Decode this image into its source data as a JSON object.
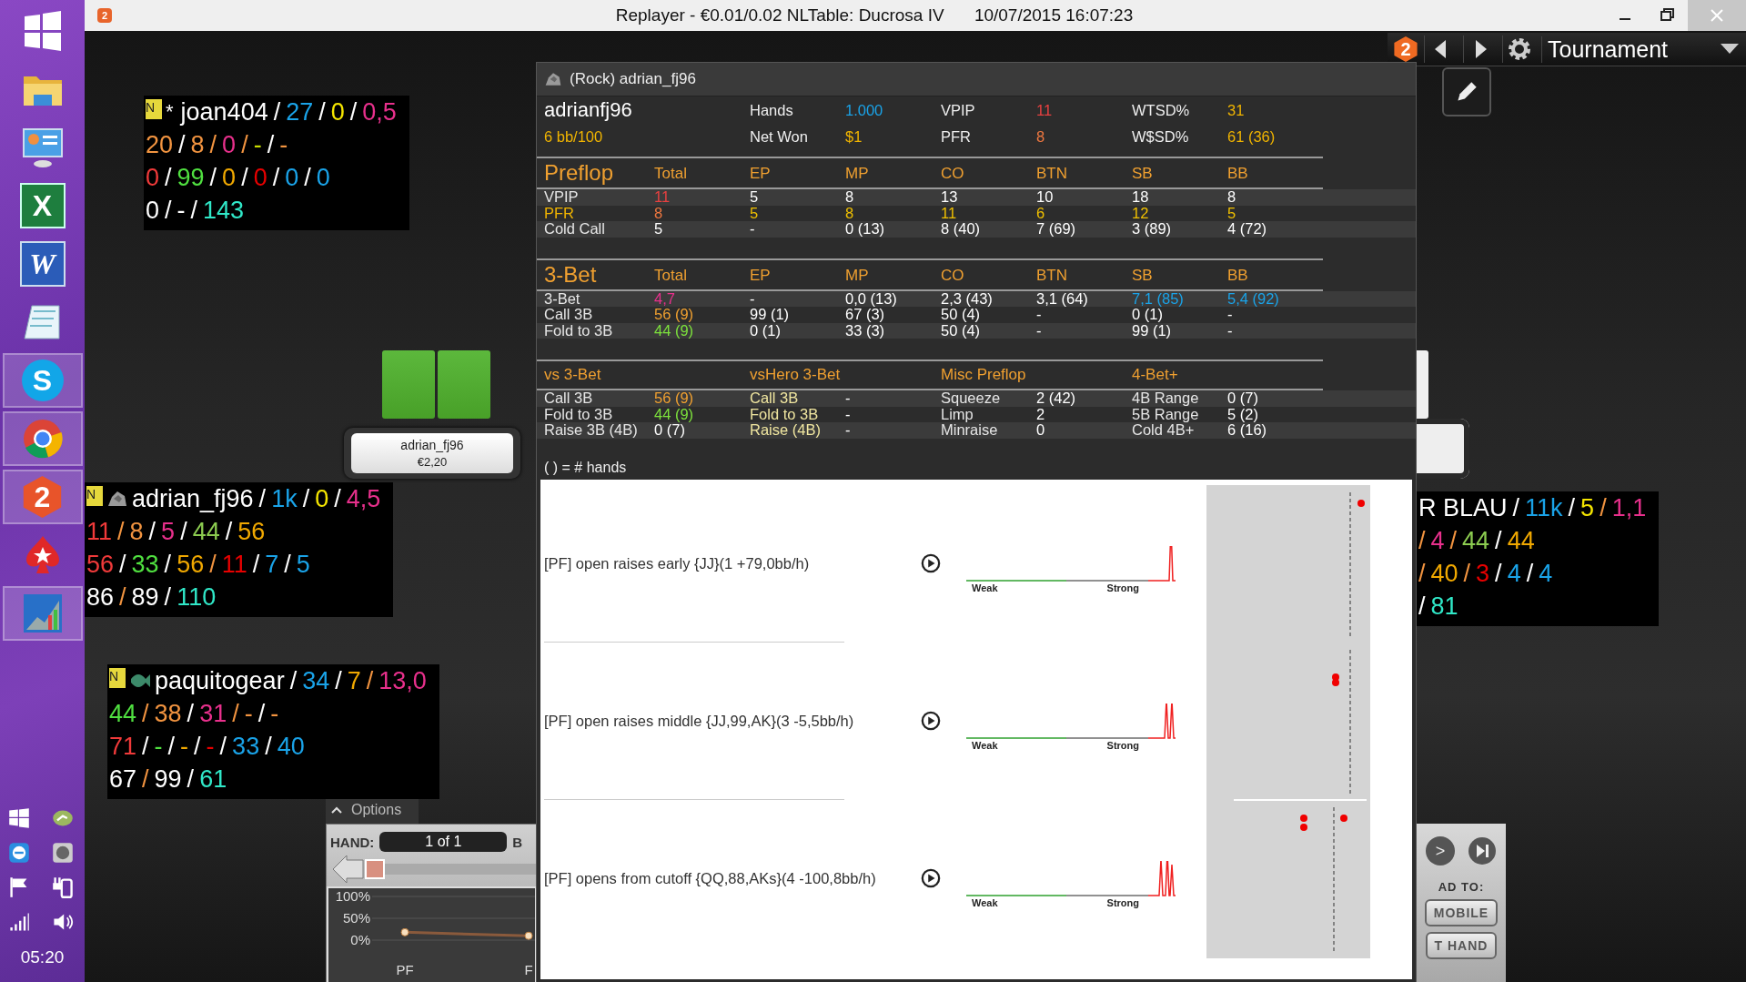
{
  "window": {
    "app_badge": "2",
    "title": "Replayer - €0.01/0.02 NLTable: Ducrosa IV",
    "timestamp": "10/07/2015 16:07:23"
  },
  "taskbar": {
    "apps": [
      {
        "kind": "start",
        "running": false
      },
      {
        "kind": "folder",
        "running": false
      },
      {
        "kind": "control-panel",
        "running": false
      },
      {
        "kind": "spreadsheet",
        "glyph": "X",
        "running": false
      },
      {
        "kind": "document",
        "glyph": "W",
        "running": false
      },
      {
        "kind": "notepad",
        "running": false
      },
      {
        "kind": "chat",
        "glyph": "S",
        "running": true
      },
      {
        "kind": "browser",
        "running": true
      },
      {
        "kind": "tracker",
        "glyph": "2",
        "running": true
      },
      {
        "kind": "poker",
        "running": false
      },
      {
        "kind": "chart",
        "running": true
      }
    ],
    "clock": "05:20"
  },
  "toolbar": {
    "badge": "2",
    "mode": "Tournament"
  },
  "huds": [
    {
      "badge": "N",
      "prefix": "*",
      "lines": [
        [
          {
            "t": "joan404",
            "color": "#ffffff"
          },
          {
            "t": "/",
            "color": "#ffffff"
          },
          {
            "t": "27",
            "color": "#1aa3e8"
          },
          {
            "t": "/",
            "color": "#ffffff"
          },
          {
            "t": "0",
            "color": "#f5e600"
          },
          {
            "t": "/",
            "color": "#ffffff"
          },
          {
            "t": "0,5",
            "color": "#e8308c"
          }
        ],
        [
          {
            "t": "20",
            "color": "#f29440"
          },
          {
            "t": "/",
            "color": "#ffffff"
          },
          {
            "t": "8",
            "color": "#f29440"
          },
          {
            "t": "/",
            "color": "#f29440"
          },
          {
            "t": "0",
            "color": "#e8308c"
          },
          {
            "t": "/",
            "color": "#f29440"
          },
          {
            "t": "-",
            "color": "#c8dc00"
          },
          {
            "t": "/",
            "color": "#ffffff"
          },
          {
            "t": "-",
            "color": "#f29440"
          }
        ],
        [
          {
            "t": "0",
            "color": "#f03a3a"
          },
          {
            "t": "/",
            "color": "#ffffff"
          },
          {
            "t": "99",
            "color": "#50e040"
          },
          {
            "t": "/",
            "color": "#ffffff"
          },
          {
            "t": "0",
            "color": "#f0a800"
          },
          {
            "t": "/",
            "color": "#ffffff"
          },
          {
            "t": "0",
            "color": "#e80000"
          },
          {
            "t": "/",
            "color": "#ffffff"
          },
          {
            "t": "0",
            "color": "#1aa3e8"
          },
          {
            "t": "/",
            "color": "#ffffff"
          },
          {
            "t": "0",
            "color": "#1aa3e8"
          }
        ],
        [
          {
            "t": "0",
            "color": "#ffffff"
          },
          {
            "t": "/",
            "color": "#ffffff"
          },
          {
            "t": "-",
            "color": "#ffffff"
          },
          {
            "t": "/",
            "color": "#ffffff"
          },
          {
            "t": "143",
            "color": "#30e8c8"
          }
        ]
      ]
    },
    {
      "badge": "N",
      "kind": "rock",
      "lines": [
        [
          {
            "t": "adrian_fj96",
            "color": "#ffffff"
          },
          {
            "t": "/",
            "color": "#ffffff"
          },
          {
            "t": "1k",
            "color": "#1aa3e8"
          },
          {
            "t": "/",
            "color": "#ffffff"
          },
          {
            "t": "0",
            "color": "#f5e600"
          },
          {
            "t": "/",
            "color": "#ffffff"
          },
          {
            "t": "4,5",
            "color": "#e8308c"
          }
        ],
        [
          {
            "t": "11",
            "color": "#f03a3a"
          },
          {
            "t": "/",
            "color": "#f29440"
          },
          {
            "t": "8",
            "color": "#f29440"
          },
          {
            "t": "/",
            "color": "#ffffff"
          },
          {
            "t": "5",
            "color": "#e8308c"
          },
          {
            "t": "/",
            "color": "#ffffff"
          },
          {
            "t": "44",
            "color": "#8ccc50"
          },
          {
            "t": "/",
            "color": "#ffffff"
          },
          {
            "t": "56",
            "color": "#f0a800"
          }
        ],
        [
          {
            "t": "56",
            "color": "#f03a3a"
          },
          {
            "t": "/",
            "color": "#ffffff"
          },
          {
            "t": "33",
            "color": "#50e040"
          },
          {
            "t": "/",
            "color": "#ffffff"
          },
          {
            "t": "56",
            "color": "#f0a800"
          },
          {
            "t": "/",
            "color": "#f29440"
          },
          {
            "t": "11",
            "color": "#e80000"
          },
          {
            "t": "/",
            "color": "#ffffff"
          },
          {
            "t": "7",
            "color": "#1aa3e8"
          },
          {
            "t": "/",
            "color": "#ffffff"
          },
          {
            "t": "5",
            "color": "#1aa3e8"
          }
        ],
        [
          {
            "t": "86",
            "color": "#ffffff"
          },
          {
            "t": "/",
            "color": "#f29440"
          },
          {
            "t": "89",
            "color": "#ffffff"
          },
          {
            "t": "/",
            "color": "#ffffff"
          },
          {
            "t": "110",
            "color": "#30e8c8"
          }
        ]
      ]
    },
    {
      "badge": "N",
      "kind": "fish",
      "lines": [
        [
          {
            "t": "paquitogear",
            "color": "#ffffff"
          },
          {
            "t": "/",
            "color": "#ffffff"
          },
          {
            "t": "34",
            "color": "#1aa3e8"
          },
          {
            "t": "/",
            "color": "#ffffff"
          },
          {
            "t": "7",
            "color": "#f0a800"
          },
          {
            "t": "/",
            "color": "#f29440"
          },
          {
            "t": "13,0",
            "color": "#e8308c"
          }
        ],
        [
          {
            "t": "44",
            "color": "#50e040"
          },
          {
            "t": "/",
            "color": "#f29440"
          },
          {
            "t": "38",
            "color": "#f29440"
          },
          {
            "t": "/",
            "color": "#ffffff"
          },
          {
            "t": "31",
            "color": "#e8308c"
          },
          {
            "t": "/",
            "color": "#f29440"
          },
          {
            "t": "-",
            "color": "#f29440"
          },
          {
            "t": "/",
            "color": "#ffffff"
          },
          {
            "t": "-",
            "color": "#f29440"
          }
        ],
        [
          {
            "t": "71",
            "color": "#f03a3a"
          },
          {
            "t": "/",
            "color": "#ffffff"
          },
          {
            "t": "-",
            "color": "#50e040"
          },
          {
            "t": "/",
            "color": "#ffffff"
          },
          {
            "t": "-",
            "color": "#f0a800"
          },
          {
            "t": "/",
            "color": "#ffffff"
          },
          {
            "t": "-",
            "color": "#e80000"
          },
          {
            "t": "/",
            "color": "#ffffff"
          },
          {
            "t": "33",
            "color": "#1aa3e8"
          },
          {
            "t": "/",
            "color": "#ffffff"
          },
          {
            "t": "40",
            "color": "#1aa3e8"
          }
        ],
        [
          {
            "t": "67",
            "color": "#ffffff"
          },
          {
            "t": "/",
            "color": "#f29440"
          },
          {
            "t": "99",
            "color": "#ffffff"
          },
          {
            "t": "/",
            "color": "#ffffff"
          },
          {
            "t": "61",
            "color": "#30e8c8"
          }
        ]
      ]
    },
    {
      "lines": [
        [
          {
            "t": "R BLAU",
            "color": "#ffffff"
          },
          {
            "t": "/",
            "color": "#ffffff"
          },
          {
            "t": "11k",
            "color": "#1aa3e8"
          },
          {
            "t": "/",
            "color": "#ffffff"
          },
          {
            "t": "5",
            "color": "#f5e600"
          },
          {
            "t": "/",
            "color": "#f29440"
          },
          {
            "t": "1,1",
            "color": "#e8308c"
          }
        ],
        [
          {
            "t": "/",
            "color": "#f29440"
          },
          {
            "t": "4",
            "color": "#e8308c"
          },
          {
            "t": "/",
            "color": "#f29440"
          },
          {
            "t": "44",
            "color": "#8ccc50"
          },
          {
            "t": "/",
            "color": "#ffffff"
          },
          {
            "t": "44",
            "color": "#f0a800"
          }
        ],
        [
          {
            "t": "/",
            "color": "#f29440"
          },
          {
            "t": "40",
            "color": "#f0a800"
          },
          {
            "t": "/",
            "color": "#f29440"
          },
          {
            "t": "3",
            "color": "#e80000"
          },
          {
            "t": "/",
            "color": "#ffffff"
          },
          {
            "t": "4",
            "color": "#1aa3e8"
          },
          {
            "t": "/",
            "color": "#ffffff"
          },
          {
            "t": "4",
            "color": "#1aa3e8"
          }
        ],
        [
          {
            "t": "/",
            "color": "#ffffff"
          },
          {
            "t": "81",
            "color": "#30e8c8"
          }
        ]
      ]
    }
  ],
  "seat": {
    "name": "adrian_fj96",
    "stack": "€2,20",
    "cards_shown": true
  },
  "popup": {
    "title": "(Rock) adrian_fj96",
    "player": "adrianfj96",
    "rate": "6 bb/100",
    "stats": [
      {
        "label": "Hands",
        "value": "1.000",
        "color": "#1aa3e8"
      },
      {
        "label": "VPIP",
        "value": "11",
        "color": "#e84040"
      },
      {
        "label": "WTSD%",
        "value": "31",
        "color": "#f0b400"
      },
      {
        "label": "Net Won",
        "value": "$1",
        "color": "#f0b400"
      },
      {
        "label": "PFR",
        "value": "8",
        "color": "#f07840"
      },
      {
        "label": "W$SD%",
        "value": "61 (36)",
        "color": "#f0b400"
      }
    ],
    "sections": [
      {
        "kind": "positions",
        "title": "Preflop",
        "headers": [
          "Total",
          "EP",
          "MP",
          "CO",
          "BTN",
          "SB",
          "BB"
        ],
        "rows": [
          [
            {
              "t": "VPIP",
              "color": "#e6e6e6"
            },
            {
              "t": "11",
              "color": "#e84040"
            },
            {
              "t": "5",
              "color": "#ffffff"
            },
            {
              "t": "8",
              "color": "#ffffff"
            },
            {
              "t": "13",
              "color": "#ffffff"
            },
            {
              "t": "10",
              "color": "#ffffff"
            },
            {
              "t": "18",
              "color": "#ffffff"
            },
            {
              "t": "8",
              "color": "#ffffff"
            }
          ],
          [
            {
              "t": "PFR",
              "color": "#f0b400"
            },
            {
              "t": "8",
              "color": "#f07840"
            },
            {
              "t": "5",
              "color": "#f0c000"
            },
            {
              "t": "8",
              "color": "#f0c000"
            },
            {
              "t": "11",
              "color": "#f0c000"
            },
            {
              "t": "6",
              "color": "#f0c000"
            },
            {
              "t": "12",
              "color": "#f0c000"
            },
            {
              "t": "5",
              "color": "#f0c000"
            }
          ],
          [
            {
              "t": "Cold Call",
              "color": "#e6e6e6"
            },
            {
              "t": "5",
              "color": "#ffffff"
            },
            {
              "t": "-",
              "color": "#ffffff"
            },
            {
              "t": "0 (13)",
              "color": "#ffffff"
            },
            {
              "t": "8 (40)",
              "color": "#ffffff"
            },
            {
              "t": "7 (69)",
              "color": "#ffffff"
            },
            {
              "t": "3 (89)",
              "color": "#ffffff"
            },
            {
              "t": "4 (72)",
              "color": "#ffffff"
            }
          ]
        ]
      },
      {
        "kind": "positions",
        "title": "3-Bet",
        "headers": [
          "Total",
          "EP",
          "MP",
          "CO",
          "BTN",
          "SB",
          "BB"
        ],
        "rows": [
          [
            {
              "t": "3-Bet",
              "color": "#e6e6e6"
            },
            {
              "t": "4,7",
              "color": "#e8308c"
            },
            {
              "t": "-",
              "color": "#ffffff"
            },
            {
              "t": "0,0 (13)",
              "color": "#ffffff"
            },
            {
              "t": "2,3 (43)",
              "color": "#ffffff"
            },
            {
              "t": "3,1 (64)",
              "color": "#ffffff"
            },
            {
              "t": "7,1 (85)",
              "color": "#1aa3e8"
            },
            {
              "t": "5,4 (92)",
              "color": "#1aa3e8"
            }
          ],
          [
            {
              "t": "Call 3B",
              "color": "#e6e6e6"
            },
            {
              "t": "56 (9)",
              "color": "#f0a030"
            },
            {
              "t": "99 (1)",
              "color": "#ffffff"
            },
            {
              "t": "67 (3)",
              "color": "#ffffff"
            },
            {
              "t": "50 (4)",
              "color": "#ffffff"
            },
            {
              "t": "-",
              "color": "#ffffff"
            },
            {
              "t": "0 (1)",
              "color": "#ffffff"
            },
            {
              "t": "-",
              "color": "#ffffff"
            }
          ],
          [
            {
              "t": "Fold to 3B",
              "color": "#e6e6e6"
            },
            {
              "t": "44 (9)",
              "color": "#7ce03c"
            },
            {
              "t": "0 (1)",
              "color": "#ffffff"
            },
            {
              "t": "33 (3)",
              "color": "#ffffff"
            },
            {
              "t": "50 (4)",
              "color": "#ffffff"
            },
            {
              "t": "-",
              "color": "#ffffff"
            },
            {
              "t": "99 (1)",
              "color": "#ffffff"
            },
            {
              "t": "-",
              "color": "#ffffff"
            }
          ]
        ]
      },
      {
        "kind": "pairs",
        "headers": [
          "vs 3-Bet",
          "vsHero 3-Bet",
          "Misc Preflop",
          "4-Bet+"
        ],
        "rows": [
          [
            {
              "t": "Call 3B",
              "color": "#e6e6e6"
            },
            {
              "t": "56 (9)",
              "color": "#f0a030"
            },
            {
              "t": "Call 3B",
              "color": "#f0e6a0"
            },
            {
              "t": "-",
              "color": "#ffffff"
            },
            {
              "t": "Squeeze",
              "color": "#e6e6e6"
            },
            {
              "t": "2 (42)",
              "color": "#ffffff"
            },
            {
              "t": "4B Range",
              "color": "#e6e6e6"
            },
            {
              "t": "0 (7)",
              "color": "#ffffff"
            }
          ],
          [
            {
              "t": "Fold to 3B",
              "color": "#e6e6e6"
            },
            {
              "t": "44 (9)",
              "color": "#7ce03c"
            },
            {
              "t": "Fold to 3B",
              "color": "#f0e6a0"
            },
            {
              "t": "-",
              "color": "#ffffff"
            },
            {
              "t": "Limp",
              "color": "#e6e6e6"
            },
            {
              "t": "2",
              "color": "#ffffff"
            },
            {
              "t": "5B Range",
              "color": "#e6e6e6"
            },
            {
              "t": "5 (2)",
              "color": "#ffffff"
            }
          ],
          [
            {
              "t": "Raise 3B (4B)",
              "color": "#e6e6e6"
            },
            {
              "t": "0 (7)",
              "color": "#ffffff"
            },
            {
              "t": "Raise (4B)",
              "color": "#f0e6a0"
            },
            {
              "t": "-",
              "color": "#ffffff"
            },
            {
              "t": "Minraise",
              "color": "#e6e6e6"
            },
            {
              "t": "0",
              "color": "#ffffff"
            },
            {
              "t": "Cold 4B+",
              "color": "#e6e6e6"
            },
            {
              "t": "6 (16)",
              "color": "#ffffff"
            }
          ]
        ]
      }
    ],
    "footnote": "( ) = # hands",
    "results": [
      {
        "text": "[PF] open raises early {JJ}(1 +79,0bb/h)",
        "weak": "Weak",
        "strong": "Strong"
      },
      {
        "text": "[PF] open raises middle {JJ,99,AK}(3 -5,5bb/h)",
        "weak": "Weak",
        "strong": "Strong"
      },
      {
        "text": "[PF] opens from cutoff {QQ,88,AKs}(4 -100,8bb/h)",
        "weak": "Weak",
        "strong": "Strong"
      }
    ]
  },
  "hand_panel": {
    "options": "Options",
    "hand_label": "HAND:",
    "hand_value": "1 of 1",
    "cut_label": "B",
    "progress": {
      "level": 0
    },
    "chart_data": {
      "type": "line",
      "marker": true,
      "categories": [
        "PF",
        "F"
      ],
      "values": [
        18,
        10
      ],
      "ylim": [
        0,
        100
      ],
      "yticks": [
        {
          "value": 100,
          "label": "100%"
        },
        {
          "value": 50,
          "label": "50%"
        },
        {
          "value": 0,
          "label": "0%"
        }
      ]
    }
  },
  "replay_controls": {
    "next": ">",
    "load_label": "AD TO:",
    "buttons": [
      "MOBILE",
      "T HAND"
    ]
  }
}
